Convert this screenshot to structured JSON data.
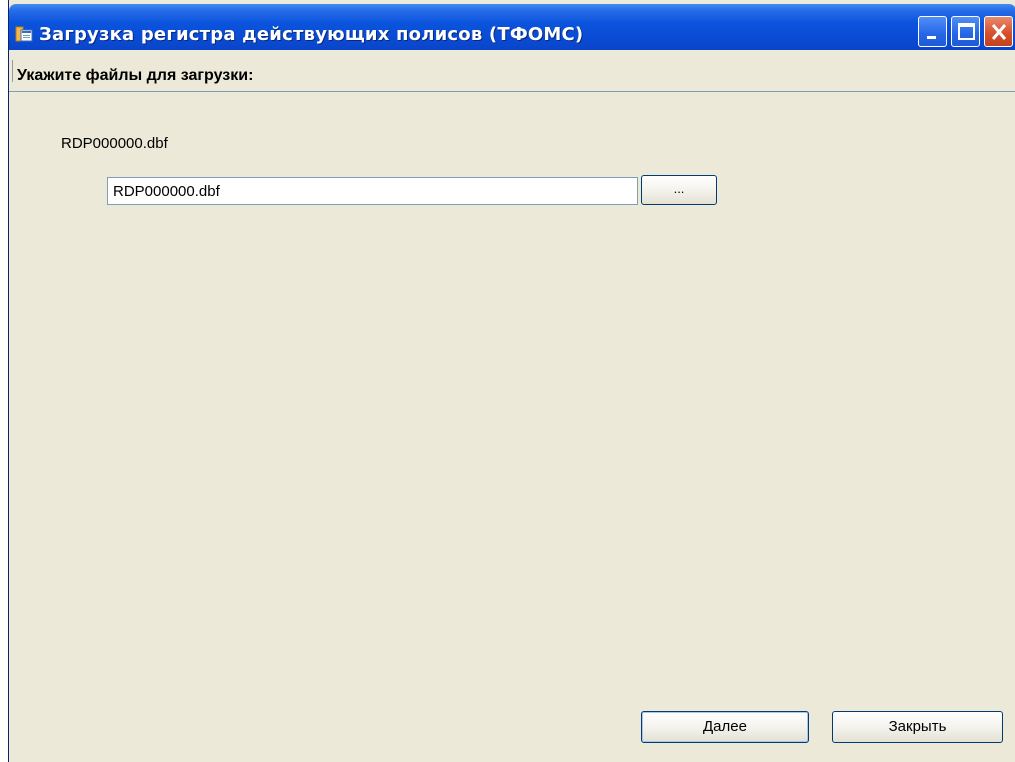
{
  "window": {
    "title": "Загрузка регистра действующих полисов (ТФОМС)",
    "controls": {
      "minimize": "minimize-icon",
      "maximize": "maximize-icon",
      "close": "close-icon"
    }
  },
  "header": {
    "label": "Укажите файлы для загрузки:"
  },
  "file": {
    "label": "RDP000000.dbf",
    "value": "RDP000000.dbf",
    "browse_label": "..."
  },
  "footer": {
    "next_label": "Далее",
    "close_label": "Закрыть"
  },
  "colors": {
    "titlebar": "#0a4cd6",
    "window_bg": "#ece9d8",
    "close_button": "#d7502c"
  }
}
